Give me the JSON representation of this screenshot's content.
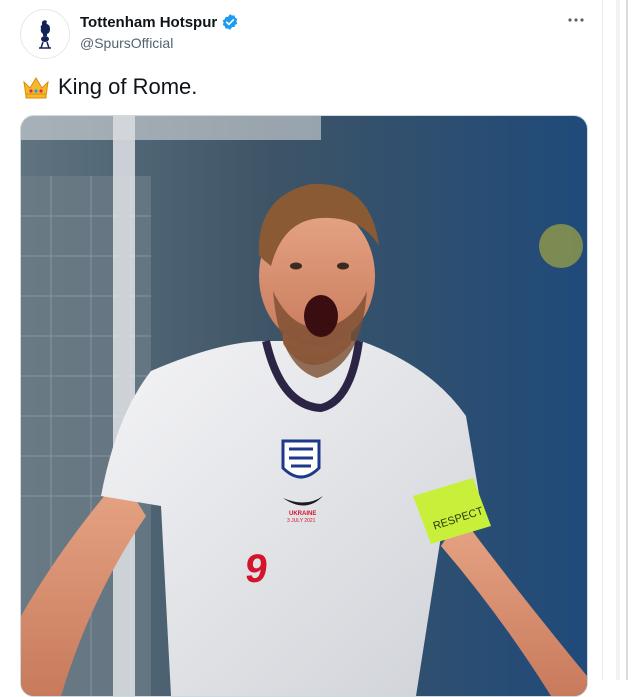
{
  "tweet": {
    "author_name": "Tottenham Hotspur",
    "author_handle": "@SpursOfficial",
    "verified": true,
    "text": "King of Rome.",
    "emoji": "crown-icon"
  },
  "photo": {
    "shirt_number": "9",
    "armband_text": "RESPECT",
    "shirt_print_line1": "UKRAINE",
    "shirt_print_line2": "3 JULY 2021"
  },
  "colors": {
    "verified_blue": "#1d9bf0",
    "armband_green": "#c8f03a",
    "shirt_red": "#d4142a"
  }
}
